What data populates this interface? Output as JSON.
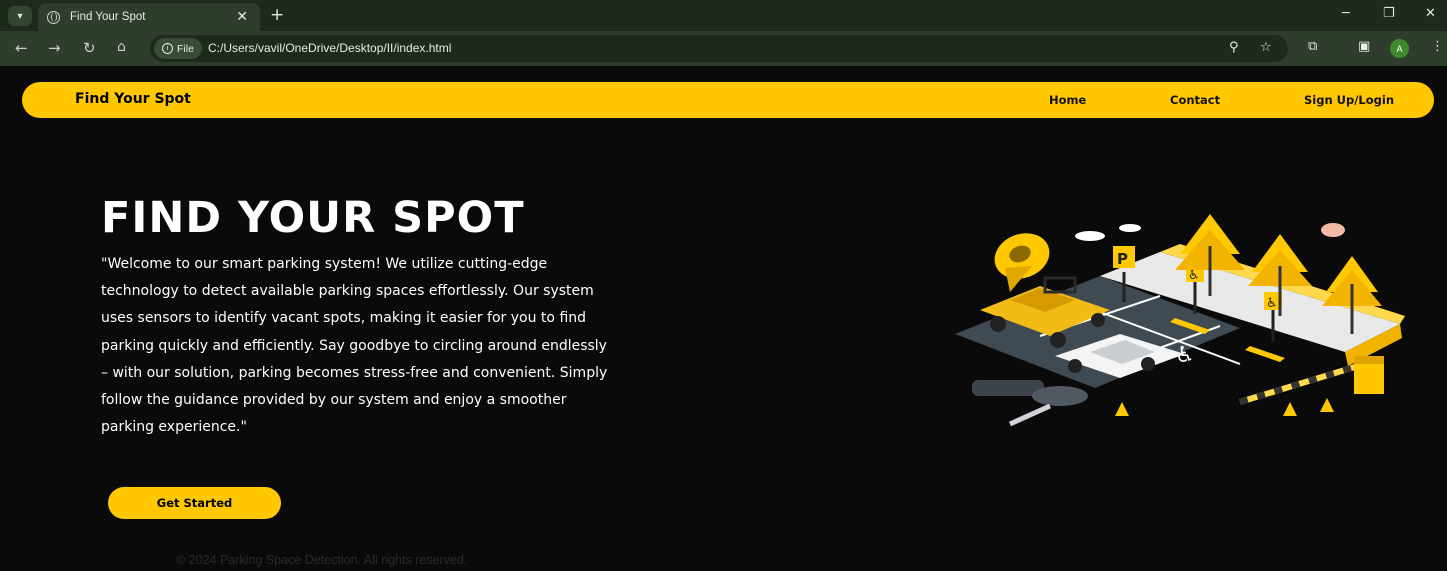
{
  "browser": {
    "tab_title": "Find Your Spot",
    "new_tab_label": "+",
    "file_chip": "File",
    "url": "C:/Users/vavil/OneDrive/Desktop/II/index.html",
    "avatar_letter": "A"
  },
  "nav": {
    "brand": "Find Your Spot",
    "links": [
      "Home",
      "Contact",
      "Sign Up/Login"
    ]
  },
  "hero": {
    "title": "FIND YOUR SPOT",
    "text": "\"Welcome to our smart parking system! We utilize cutting-edge technology to detect available parking spaces effortlessly. Our system uses sensors to identify vacant spots, making it easier for you to find parking quickly and efficiently. Say goodbye to circling around endlessly – with our solution, parking becomes stress-free and convenient. Simply follow the guidance provided by our system and enjoy a smoother parking experience.\"",
    "cta": "Get Started"
  },
  "footer": "© 2024 Parking Space Detection. All rights reserved.",
  "colors": {
    "accent": "#ffc800",
    "background": "#0a0a0a",
    "chrome": "#2f3d2d"
  },
  "illustration": {
    "parking_sign": "P"
  }
}
